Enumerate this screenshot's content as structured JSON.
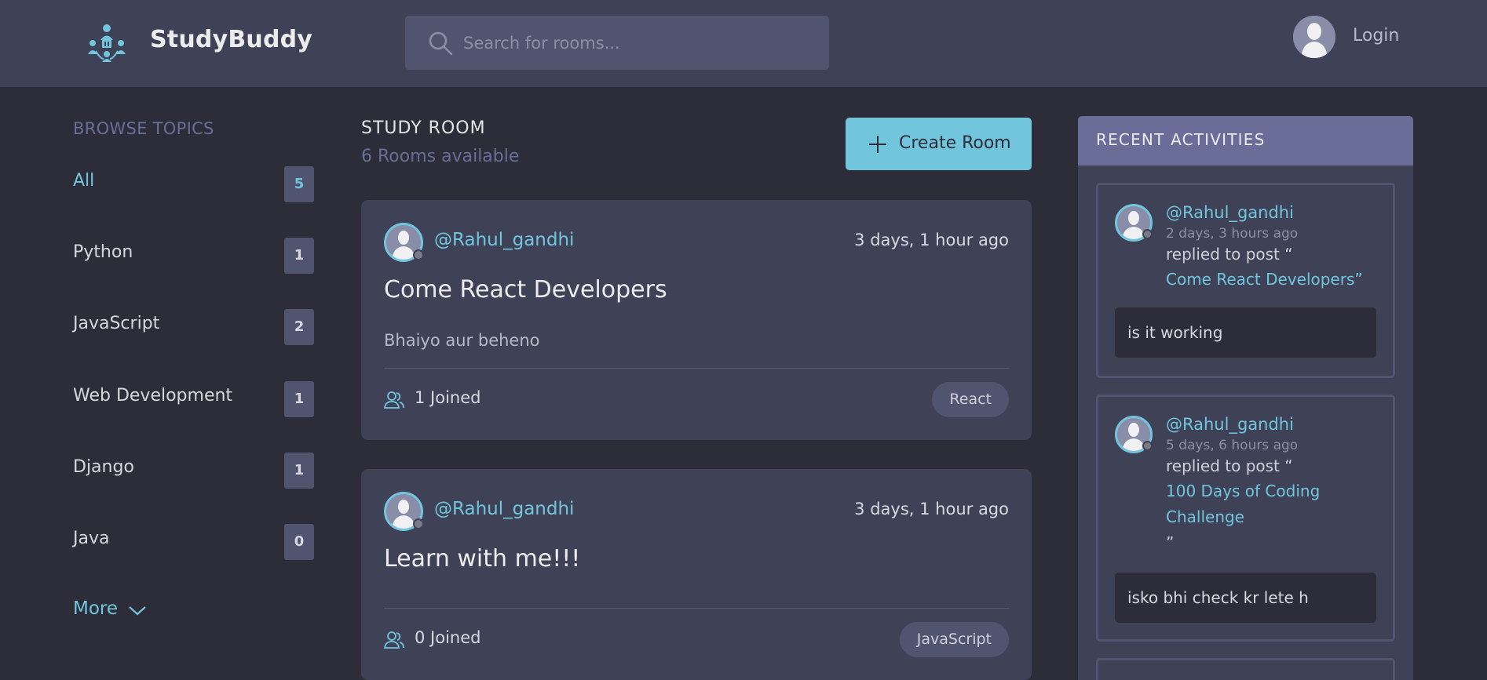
{
  "header": {
    "brand": "StudyBuddy",
    "search_placeholder": "Search for rooms...",
    "login_label": "Login"
  },
  "sidebar": {
    "title": "BROWSE TOPICS",
    "topics": [
      {
        "label": "All",
        "count": "5"
      },
      {
        "label": "Python",
        "count": "1"
      },
      {
        "label": "JavaScript",
        "count": "2"
      },
      {
        "label": "Web Development",
        "count": "1"
      },
      {
        "label": "Django",
        "count": "1"
      },
      {
        "label": "Java",
        "count": "0"
      }
    ],
    "more_label": "More"
  },
  "main": {
    "heading": "STUDY ROOM",
    "subheading": "6 Rooms available",
    "create_label": "Create Room",
    "rooms": [
      {
        "host": "@Rahul_gandhi",
        "time": "3 days, 1 hour ago",
        "title": "Come React Developers",
        "description": "Bhaiyo aur beheno",
        "joined": "1 Joined",
        "topic": "React"
      },
      {
        "host": "@Rahul_gandhi",
        "time": "3 days, 1 hour ago",
        "title": "Learn with me!!!",
        "description": "",
        "joined": "0 Joined",
        "topic": "JavaScript"
      }
    ]
  },
  "activity": {
    "title": "RECENT ACTIVITIES",
    "items": [
      {
        "user": "@Rahul_gandhi",
        "time": "2 days, 3 hours ago",
        "action": "replied to post “",
        "post_line1": "Come React Developers”",
        "post_line2": "",
        "quote_end": "",
        "reply": "is it working"
      },
      {
        "user": "@Rahul_gandhi",
        "time": "5 days, 6 hours ago",
        "action": "replied to post “",
        "post_line1": "100 Days of Coding",
        "post_line2": "Challenge",
        "quote_end": "”",
        "reply": "isko bhi check kr lete h"
      }
    ]
  },
  "colors": {
    "accent": "#71c6dd",
    "header_bg": "#3f4156",
    "page_bg": "#2d2d39",
    "muted_purple": "#696d97"
  }
}
